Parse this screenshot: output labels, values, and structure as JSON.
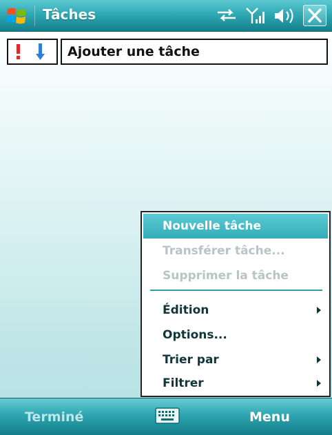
{
  "title_bar": {
    "title": "Tâches",
    "icons": [
      "windows-start-icon",
      "connectivity-icon",
      "signal-icon",
      "volume-icon",
      "close-icon"
    ],
    "accent_color": "#2fa9b4"
  },
  "entry_row": {
    "priority_high_icon": "exclamation-icon",
    "priority_low_icon": "down-arrow-icon",
    "placeholder": "Ajouter une tâche"
  },
  "menu": {
    "items": [
      {
        "label": "Nouvelle tâche",
        "state": "selected",
        "has_submenu": false
      },
      {
        "label": "Transférer tâche...",
        "state": "disabled",
        "has_submenu": false
      },
      {
        "label": "Supprimer la tâche",
        "state": "disabled",
        "has_submenu": false
      },
      {
        "label": "Édition",
        "state": "enabled",
        "has_submenu": true
      },
      {
        "label": "Options...",
        "state": "enabled",
        "has_submenu": false
      },
      {
        "label": "Trier par",
        "state": "enabled",
        "has_submenu": true
      },
      {
        "label": "Filtrer",
        "state": "enabled",
        "has_submenu": true
      }
    ]
  },
  "soft_keys": {
    "left": "Terminé",
    "center_icon": "keyboard-icon",
    "right": "Menu"
  }
}
